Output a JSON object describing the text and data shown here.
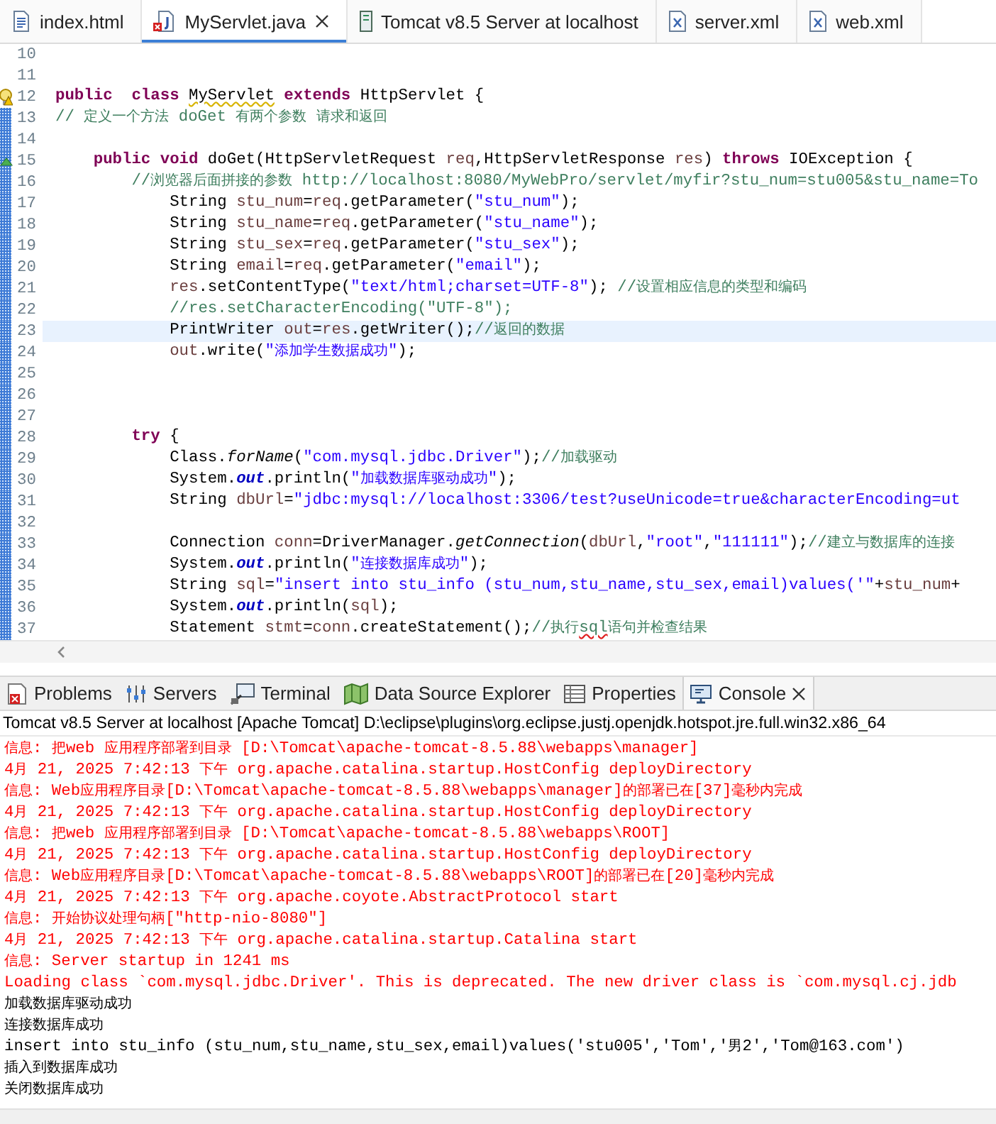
{
  "editor_tabs": [
    {
      "label": "index.html",
      "kind": "html",
      "selected": false
    },
    {
      "label": "MyServlet.java",
      "kind": "java",
      "selected": true
    },
    {
      "label": "Tomcat v8.5 Server at localhost",
      "kind": "server",
      "selected": false
    },
    {
      "label": "server.xml",
      "kind": "xml",
      "selected": false
    },
    {
      "label": "web.xml",
      "kind": "xml",
      "selected": false
    }
  ],
  "lines": [
    {
      "number": "10",
      "changed": false,
      "current": false
    },
    {
      "number": "11",
      "changed": false,
      "current": false
    },
    {
      "number": "12",
      "changed": false,
      "current": false,
      "marker": {
        "kind": "warning"
      },
      "segments": [
        {
          "kind": "keyword",
          "text": "public  class "
        },
        {
          "kind": "warning",
          "text": "MyServlet"
        },
        {
          "kind": "keyword",
          "text": " extends"
        },
        {
          "kind": "plain",
          "text": " HttpServlet {"
        }
      ]
    },
    {
      "number": "13",
      "changed": true,
      "current": false,
      "segments": [
        {
          "kind": "comment",
          "text": "// 定义一个方法 doGet 有两个参数 请求和返回"
        }
      ]
    },
    {
      "number": "14",
      "changed": true,
      "current": false
    },
    {
      "number": "15",
      "changed": true,
      "current": false,
      "marker": {
        "kind": "override"
      },
      "segments": [
        {
          "kind": "keyword",
          "text": "    public void"
        },
        {
          "kind": "plain",
          "text": " doGet(HttpServletRequest "
        },
        {
          "kind": "variable",
          "text": "req"
        },
        {
          "kind": "plain",
          "text": ",HttpServletResponse "
        },
        {
          "kind": "variable",
          "text": "res"
        },
        {
          "kind": "plain",
          "text": ") "
        },
        {
          "kind": "keyword",
          "text": "throws"
        },
        {
          "kind": "plain",
          "text": " IOException {"
        }
      ]
    },
    {
      "number": "16",
      "changed": true,
      "current": false,
      "segments": [
        {
          "kind": "comment",
          "text": "        //浏览器后面拼接的参数 http://localhost:8080/MyWebPro/servlet/myfir?stu_num=stu005&stu_name=To"
        }
      ]
    },
    {
      "number": "17",
      "changed": true,
      "current": false,
      "segments": [
        {
          "kind": "plain",
          "text": "            String "
        },
        {
          "kind": "variable",
          "text": "stu_num"
        },
        {
          "kind": "plain",
          "text": "="
        },
        {
          "kind": "variable",
          "text": "req"
        },
        {
          "kind": "plain",
          "text": ".getParameter("
        },
        {
          "kind": "string",
          "text": "\"stu_num\""
        },
        {
          "kind": "plain",
          "text": ");"
        }
      ]
    },
    {
      "number": "18",
      "changed": true,
      "current": false,
      "segments": [
        {
          "kind": "plain",
          "text": "            String "
        },
        {
          "kind": "variable",
          "text": "stu_name"
        },
        {
          "kind": "plain",
          "text": "="
        },
        {
          "kind": "variable",
          "text": "req"
        },
        {
          "kind": "plain",
          "text": ".getParameter("
        },
        {
          "kind": "string",
          "text": "\"stu_name\""
        },
        {
          "kind": "plain",
          "text": ");"
        }
      ]
    },
    {
      "number": "19",
      "changed": true,
      "current": false,
      "segments": [
        {
          "kind": "plain",
          "text": "            String "
        },
        {
          "kind": "variable",
          "text": "stu_sex"
        },
        {
          "kind": "plain",
          "text": "="
        },
        {
          "kind": "variable",
          "text": "req"
        },
        {
          "kind": "plain",
          "text": ".getParameter("
        },
        {
          "kind": "string",
          "text": "\"stu_sex\""
        },
        {
          "kind": "plain",
          "text": ");"
        }
      ]
    },
    {
      "number": "20",
      "changed": true,
      "current": false,
      "segments": [
        {
          "kind": "plain",
          "text": "            String "
        },
        {
          "kind": "variable",
          "text": "email"
        },
        {
          "kind": "plain",
          "text": "="
        },
        {
          "kind": "variable",
          "text": "req"
        },
        {
          "kind": "plain",
          "text": ".getParameter("
        },
        {
          "kind": "string",
          "text": "\"email\""
        },
        {
          "kind": "plain",
          "text": ");"
        }
      ]
    },
    {
      "number": "21",
      "changed": true,
      "current": false,
      "segments": [
        {
          "kind": "variable",
          "text": "            res"
        },
        {
          "kind": "plain",
          "text": ".setContentType("
        },
        {
          "kind": "string",
          "text": "\"text/html;charset=UTF-8\""
        },
        {
          "kind": "plain",
          "text": "); "
        },
        {
          "kind": "comment",
          "text": "//设置相应信息的类型和编码"
        }
      ]
    },
    {
      "number": "22",
      "changed": true,
      "current": false,
      "segments": [
        {
          "kind": "comment",
          "text": "            //res.setCharacterEncoding(\"UTF-8\");"
        }
      ]
    },
    {
      "number": "23",
      "changed": true,
      "current": true,
      "segments": [
        {
          "kind": "plain",
          "text": "            PrintWriter "
        },
        {
          "kind": "variable",
          "text": "out"
        },
        {
          "kind": "plain",
          "text": "="
        },
        {
          "kind": "variable",
          "text": "res"
        },
        {
          "kind": "plain",
          "text": ".getWriter();"
        },
        {
          "kind": "comment",
          "text": "//返回的数据"
        }
      ]
    },
    {
      "number": "24",
      "changed": true,
      "current": false,
      "segments": [
        {
          "kind": "variable",
          "text": "            out"
        },
        {
          "kind": "plain",
          "text": ".write("
        },
        {
          "kind": "string",
          "text": "\"添加学生数据成功\""
        },
        {
          "kind": "plain",
          "text": ");"
        }
      ]
    },
    {
      "number": "25",
      "changed": true,
      "current": false
    },
    {
      "number": "26",
      "changed": true,
      "current": false
    },
    {
      "number": "27",
      "changed": true,
      "current": false
    },
    {
      "number": "28",
      "changed": true,
      "current": false,
      "segments": [
        {
          "kind": "keyword",
          "text": "        try"
        },
        {
          "kind": "plain",
          "text": " {"
        }
      ]
    },
    {
      "number": "29",
      "changed": true,
      "current": false,
      "segments": [
        {
          "kind": "plain",
          "text": "            Class."
        },
        {
          "kind": "static",
          "text": "forName"
        },
        {
          "kind": "plain",
          "text": "("
        },
        {
          "kind": "string",
          "text": "\"com.mysql.jdbc.Driver\""
        },
        {
          "kind": "plain",
          "text": ");"
        },
        {
          "kind": "comment",
          "text": "//加载驱动"
        }
      ]
    },
    {
      "number": "30",
      "changed": true,
      "current": false,
      "segments": [
        {
          "kind": "plain",
          "text": "            System."
        },
        {
          "kind": "field",
          "text": "out"
        },
        {
          "kind": "plain",
          "text": ".println("
        },
        {
          "kind": "string",
          "text": "\"加载数据库驱动成功\""
        },
        {
          "kind": "plain",
          "text": ");"
        }
      ]
    },
    {
      "number": "31",
      "changed": true,
      "current": false,
      "segments": [
        {
          "kind": "plain",
          "text": "            String "
        },
        {
          "kind": "variable",
          "text": "dbUrl"
        },
        {
          "kind": "plain",
          "text": "="
        },
        {
          "kind": "string",
          "text": "\"jdbc:mysql://localhost:3306/test?useUnicode=true&characterEncoding=ut"
        }
      ]
    },
    {
      "number": "32",
      "changed": true,
      "current": false
    },
    {
      "number": "33",
      "changed": true,
      "current": false,
      "segments": [
        {
          "kind": "plain",
          "text": "            Connection "
        },
        {
          "kind": "variable",
          "text": "conn"
        },
        {
          "kind": "plain",
          "text": "=DriverManager."
        },
        {
          "kind": "static",
          "text": "getConnection"
        },
        {
          "kind": "plain",
          "text": "("
        },
        {
          "kind": "variable",
          "text": "dbUrl"
        },
        {
          "kind": "plain",
          "text": ","
        },
        {
          "kind": "string",
          "text": "\"root\""
        },
        {
          "kind": "plain",
          "text": ","
        },
        {
          "kind": "string",
          "text": "\"111111\""
        },
        {
          "kind": "plain",
          "text": ");"
        },
        {
          "kind": "comment",
          "text": "//建立与数据库的连接"
        }
      ]
    },
    {
      "number": "34",
      "changed": true,
      "current": false,
      "segments": [
        {
          "kind": "plain",
          "text": "            System."
        },
        {
          "kind": "field",
          "text": "out"
        },
        {
          "kind": "plain",
          "text": ".println("
        },
        {
          "kind": "string",
          "text": "\"连接数据库成功\""
        },
        {
          "kind": "plain",
          "text": ");"
        }
      ]
    },
    {
      "number": "35",
      "changed": true,
      "current": false,
      "segments": [
        {
          "kind": "plain",
          "text": "            String "
        },
        {
          "kind": "variable",
          "text": "sql"
        },
        {
          "kind": "plain",
          "text": "="
        },
        {
          "kind": "string",
          "text": "\"insert into stu_info (stu_num,stu_name,stu_sex,email)values('\""
        },
        {
          "kind": "plain",
          "text": "+"
        },
        {
          "kind": "variable",
          "text": "stu_num"
        },
        {
          "kind": "plain",
          "text": "+"
        }
      ]
    },
    {
      "number": "36",
      "changed": true,
      "current": false,
      "segments": [
        {
          "kind": "plain",
          "text": "            System."
        },
        {
          "kind": "field",
          "text": "out"
        },
        {
          "kind": "plain",
          "text": ".println("
        },
        {
          "kind": "variable",
          "text": "sql"
        },
        {
          "kind": "plain",
          "text": ");"
        }
      ]
    },
    {
      "number": "37",
      "changed": true,
      "current": false,
      "segments": [
        {
          "kind": "plain",
          "text": "            Statement "
        },
        {
          "kind": "variable",
          "text": "stmt"
        },
        {
          "kind": "plain",
          "text": "="
        },
        {
          "kind": "variable",
          "text": "conn"
        },
        {
          "kind": "plain",
          "text": ".createStatement();"
        },
        {
          "kind": "comment",
          "text": "//执行"
        },
        {
          "kind": "misspelled",
          "text": "sql"
        },
        {
          "kind": "comment",
          "text": "语句并检查结果"
        }
      ]
    }
  ],
  "view_tabs": [
    {
      "label": "Problems",
      "kind": "problems",
      "selected": false
    },
    {
      "label": "Servers",
      "kind": "servers",
      "selected": false
    },
    {
      "label": "Terminal",
      "kind": "terminal",
      "selected": false
    },
    {
      "label": "Data Source Explorer",
      "kind": "datasource",
      "selected": false
    },
    {
      "label": "Properties",
      "kind": "properties",
      "selected": false
    },
    {
      "label": "Console",
      "kind": "console",
      "selected": true
    }
  ],
  "console": {
    "title": "Tomcat v8.5 Server at localhost [Apache Tomcat] D:\\eclipse\\plugins\\org.eclipse.justj.openjdk.hotspot.jre.full.win32.x86_64",
    "lines": [
      {
        "kind": "stderr",
        "text": "信息: 把web 应用程序部署到目录 [D:\\Tomcat\\apache-tomcat-8.5.88\\webapps\\manager]"
      },
      {
        "kind": "stderr",
        "text": "4月 21, 2025 7:42:13 下午 org.apache.catalina.startup.HostConfig deployDirectory"
      },
      {
        "kind": "stderr",
        "text": "信息: Web应用程序目录[D:\\Tomcat\\apache-tomcat-8.5.88\\webapps\\manager]的部署已在[37]毫秒内完成"
      },
      {
        "kind": "stderr",
        "text": "4月 21, 2025 7:42:13 下午 org.apache.catalina.startup.HostConfig deployDirectory"
      },
      {
        "kind": "stderr",
        "text": "信息: 把web 应用程序部署到目录 [D:\\Tomcat\\apache-tomcat-8.5.88\\webapps\\ROOT]"
      },
      {
        "kind": "stderr",
        "text": "4月 21, 2025 7:42:13 下午 org.apache.catalina.startup.HostConfig deployDirectory"
      },
      {
        "kind": "stderr",
        "text": "信息: Web应用程序目录[D:\\Tomcat\\apache-tomcat-8.5.88\\webapps\\ROOT]的部署已在[20]毫秒内完成"
      },
      {
        "kind": "stderr",
        "text": "4月 21, 2025 7:42:13 下午 org.apache.coyote.AbstractProtocol start"
      },
      {
        "kind": "stderr",
        "text": "信息: 开始协议处理句柄[\"http-nio-8080\"]"
      },
      {
        "kind": "stderr",
        "text": "4月 21, 2025 7:42:13 下午 org.apache.catalina.startup.Catalina start"
      },
      {
        "kind": "stderr",
        "text": "信息: Server startup in 1241 ms"
      },
      {
        "kind": "stderr",
        "text": "Loading class `com.mysql.jdbc.Driver'. This is deprecated. The new driver class is `com.mysql.cj.jdb"
      },
      {
        "kind": "stdout",
        "text": "加载数据库驱动成功"
      },
      {
        "kind": "stdout",
        "text": "连接数据库成功"
      },
      {
        "kind": "stdout",
        "text": "insert into stu_info (stu_num,stu_name,stu_sex,email)values('stu005','Tom','男2','Tom@163.com')"
      },
      {
        "kind": "stdout",
        "text": "插入到数据库成功"
      },
      {
        "kind": "stdout",
        "text": "关闭数据库成功"
      }
    ]
  }
}
